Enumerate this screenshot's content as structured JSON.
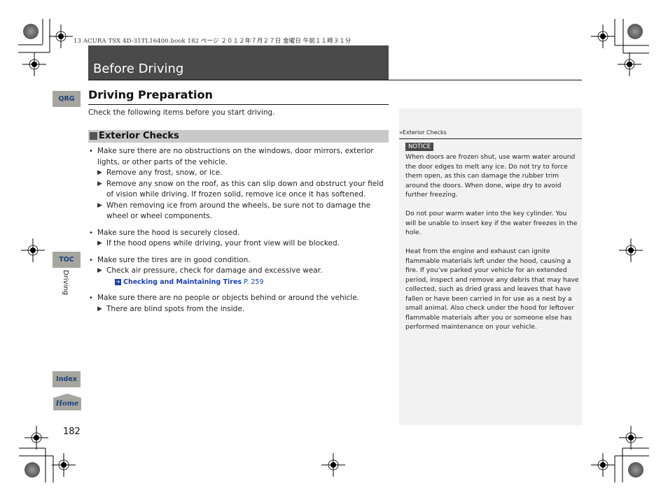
{
  "print_header": "13 ACURA TSX 4D-31TL16400.book  182 ページ  ２０１２年７月２７日  金曜日  午前１１時３１分",
  "chapter": {
    "title": "Before Driving"
  },
  "side_nav": {
    "qrg": "QRG",
    "toc": "TOC",
    "index": "Index",
    "home": "Home",
    "section_label": "Driving"
  },
  "page_number": "182",
  "section": {
    "title": "Driving Preparation",
    "intro": "Check the following items before you start driving."
  },
  "subsection": {
    "title": "Exterior Checks",
    "items": [
      {
        "text": "Make sure there are no obstructions on the windows, door mirrors, exterior lights, or other parts of the vehicle.",
        "subs": [
          "Remove any frost, snow, or ice.",
          "Remove any snow on the roof, as this can slip down and obstruct your field of vision while driving. If frozen solid, remove ice once it has softened.",
          "When removing ice from around the wheels, be sure not to damage the wheel or wheel components."
        ]
      },
      {
        "text": "Make sure the hood is securely closed.",
        "subs": [
          "If the hood opens while driving, your front view will be blocked."
        ]
      },
      {
        "text": "Make sure the tires are in good condition.",
        "subs": [
          "Check air pressure, check for damage and excessive wear."
        ],
        "xref": {
          "title": "Checking and Maintaining Tires",
          "page": "P. 259"
        }
      },
      {
        "text": "Make sure there are no people or objects behind or around the vehicle.",
        "subs": [
          "There are blind spots from the inside."
        ]
      }
    ]
  },
  "side_panel": {
    "heading": "Exterior Checks",
    "notice_label": "NOTICE",
    "paragraphs": [
      "When doors are frozen shut, use warm water around the door edges to melt any ice. Do not try to force them open, as this can damage the rubber trim around the doors. When done, wipe dry to avoid further freezing.",
      "Do not pour warm water into the key cylinder. You will be unable to insert key if the water freezes in the hole.",
      "Heat from the engine and exhaust can ignite flammable materials left under the hood, causing a fire. If you’ve parked your vehicle for an extended period, inspect and remove any debris that may have collected, such as dried grass and leaves that have fallen or have been carried in for use as a nest by a small animal. Also check under the hood for leftover flammable materials after you or someone else has performed maintenance on your vehicle."
    ]
  },
  "colors": {
    "banner": "#4a4a4a",
    "nav_button": "#a6a6a0",
    "nav_text": "#1c3f7a",
    "link": "#1a3fb0",
    "panel_bg": "#f2f2f2",
    "subsection_bar": "#c9c9c9"
  }
}
